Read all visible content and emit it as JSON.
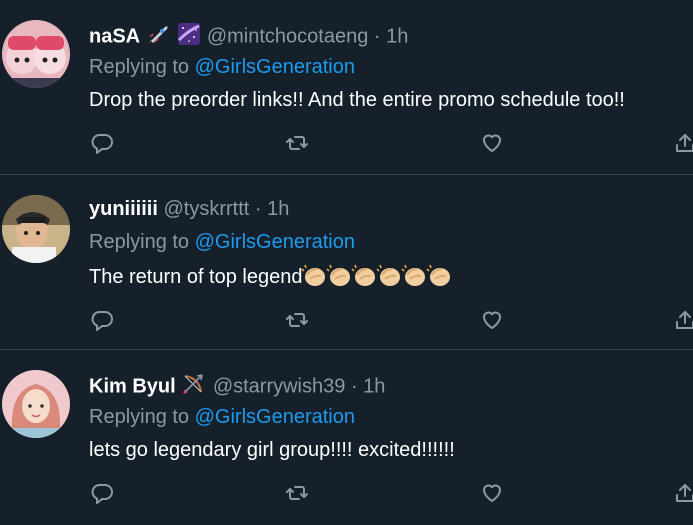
{
  "tweets": [
    {
      "display_name": "naSA",
      "name_emoji": [
        "rocket-emoji",
        "milky-way-emoji"
      ],
      "handle": "@mintchocotaeng",
      "dot": "·",
      "time": "1h",
      "replying_prefix": "Replying to ",
      "replying_handle": "@GirlsGeneration",
      "text": "Drop the preorder links!! And the entire promo schedule too!!",
      "text_suffix_emoji": []
    },
    {
      "display_name": "yuniiiiii",
      "name_emoji": [],
      "handle": "@tyskrrttt",
      "dot": "·",
      "time": "1h",
      "replying_prefix": "Replying to ",
      "replying_handle": "@GirlsGeneration",
      "text": "The return of top legend",
      "text_suffix_emoji": [
        "clapping-hands-emoji",
        "clapping-hands-emoji",
        "clapping-hands-emoji",
        "clapping-hands-emoji",
        "clapping-hands-emoji",
        "clapping-hands-emoji"
      ]
    },
    {
      "display_name": "Kim Byul",
      "name_emoji": [
        "bow-and-arrow-emoji"
      ],
      "handle": "@starrywish39",
      "dot": "·",
      "time": "1h",
      "replying_prefix": "Replying to ",
      "replying_handle": "@GirlsGeneration",
      "text": "lets go legendary girl group!!!! excited!!!!!!",
      "text_suffix_emoji": []
    }
  ],
  "icons": {
    "reply": "reply-icon",
    "retweet": "retweet-icon",
    "like": "like-icon",
    "share": "share-icon"
  },
  "colors": {
    "background": "#15202b",
    "muted": "#8b98a5",
    "link": "#1d9bf0",
    "divider": "#38444d"
  }
}
